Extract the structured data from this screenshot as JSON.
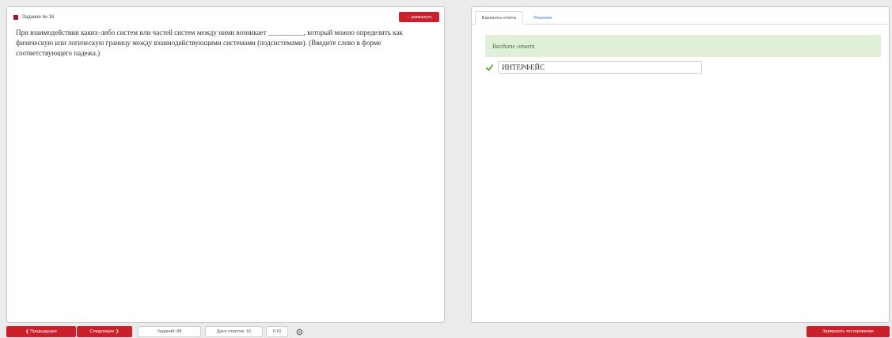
{
  "task": {
    "title": "Задание № 16",
    "expand_label": "↔ развернуть",
    "question": "При взаимодействии каких-либо систем или частей систем между ними возникает __________, который можно определить как физическую или логическую границу между взаимодействующими системами (подсистемами). (Введите слово в форме соответствующего падежа.)"
  },
  "answer_panel": {
    "tabs": [
      {
        "label": "Варианты ответа",
        "active": true
      },
      {
        "label": "Решение",
        "active": false
      }
    ],
    "hint": "Введите ответ",
    "answer_value": "ИНТЕРФЕЙС"
  },
  "footer": {
    "prev_label": "❮ Предыдущее",
    "next_label": "Следующее ❯",
    "tasks_label": "Заданий: 88",
    "answered_label": "Дано ответов: 16",
    "time": "6:16",
    "finish_label": "Завершить тестирование"
  },
  "colors": {
    "accent_red": "#c9202b",
    "hint_green": "#dfefd8",
    "check_green": "#5aa33a",
    "link_blue": "#3a7bc8"
  }
}
